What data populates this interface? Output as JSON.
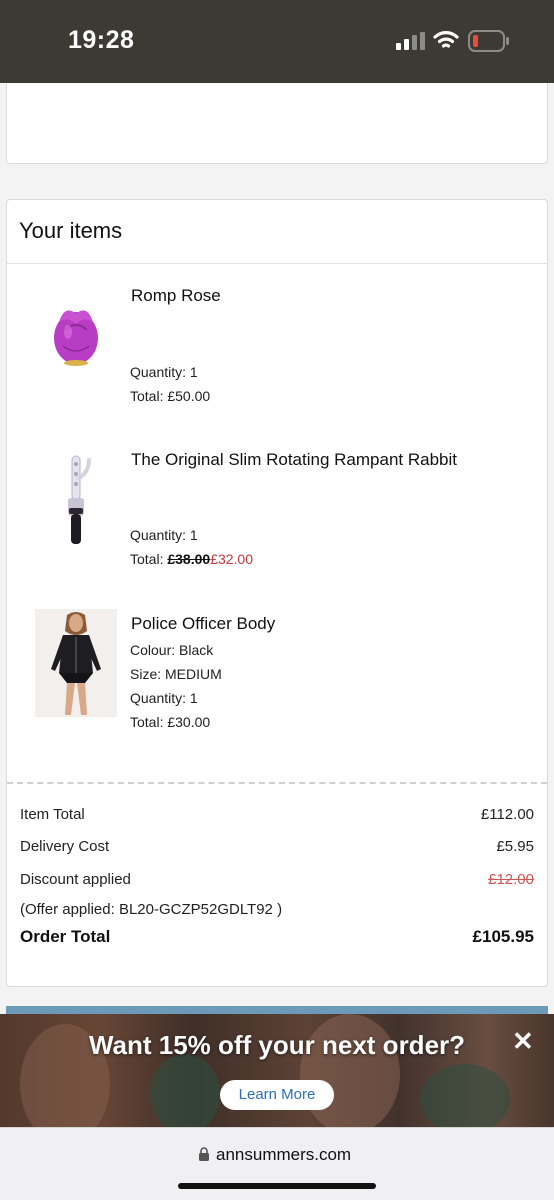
{
  "status_bar": {
    "time": "19:28",
    "icons": [
      "signal-icon",
      "wifi-icon",
      "battery-icon"
    ],
    "battery_color": "#e74c3c"
  },
  "items_section": {
    "title": "Your items",
    "items": [
      {
        "name": "Romp Rose",
        "image": "pink-rose-toy-image",
        "quantity_label": "Quantity:  1",
        "total_label": "Total:",
        "total": "£50.00"
      },
      {
        "name": "The Original Slim Rotating Rampant Rabbit",
        "image": "rabbit-toy-image",
        "quantity_label": "Quantity:  1",
        "total_label": "Total:",
        "original_price": "£38.00",
        "sale_price": "£32.00"
      },
      {
        "name": "Police Officer Body",
        "image": "police-officer-body-image",
        "colour": "Colour: Black",
        "size": "Size: MEDIUM",
        "quantity_label": "Quantity:  1",
        "total_label": "Total:",
        "total": "£30.00"
      }
    ]
  },
  "summary": {
    "item_total_label": "Item Total",
    "item_total": "£112.00",
    "delivery_label": "Delivery Cost",
    "delivery": "£5.95",
    "discount_label": "Discount applied",
    "discount": "£12.00",
    "offer_note": "(Offer applied: BL20-GCZP52GDLT92 )",
    "order_total_label": "Order Total",
    "order_total": "£105.95"
  },
  "banner": {
    "headline": "Want 15% off your next order?",
    "cta": "Learn More",
    "close": "✕"
  },
  "browser": {
    "url": "annsummers.com"
  },
  "colors": {
    "status_bar": "#3c3a33",
    "sale_red": "#c8343a",
    "link_blue": "#2d6fb4"
  }
}
